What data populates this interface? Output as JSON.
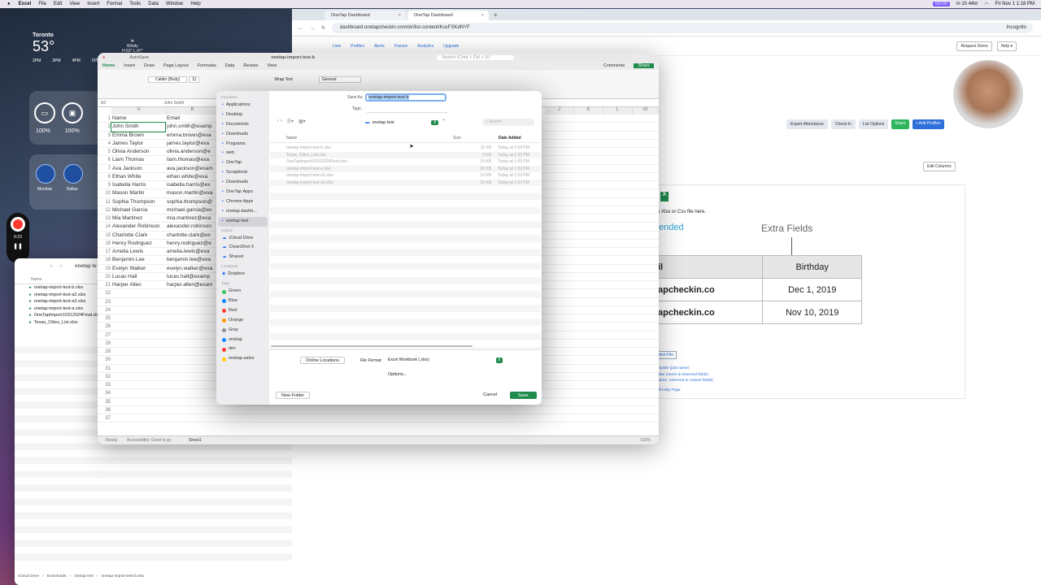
{
  "menubar": {
    "apple": "",
    "app": "Excel",
    "items": [
      "File",
      "Edit",
      "View",
      "Insert",
      "Format",
      "Tools",
      "Data",
      "Window",
      "Help"
    ],
    "right_chip": "00:00",
    "timer": "in 1h 44m",
    "datetime": "Fri Nov 1  1:18 PM"
  },
  "weather": {
    "city": "Toronto",
    "temp": "53°",
    "cond": "Windy",
    "hilo": "H:63° L:47°",
    "hours": [
      "2PM",
      "3PM",
      "4PM",
      "5PM",
      "6PM"
    ],
    "temps": [
      "58°",
      "58°",
      "58°",
      "57°",
      "56°"
    ]
  },
  "battery": {
    "values": [
      "100%",
      "100%",
      "10"
    ]
  },
  "world_clocks": [
    {
      "city": "Mumbai",
      "day": "Today",
      "offset": "+9:30"
    },
    {
      "city": "Dallas",
      "day": "Today",
      "offset": "-1:00"
    },
    {
      "city": "Lon",
      "day": "",
      "offset": ""
    }
  ],
  "recorder": {
    "time": "6:23"
  },
  "finder": {
    "crumb": "onetap te",
    "header": "Name",
    "files": [
      "onetap-import-test-b.xlsx",
      "onetap-import-test-a2.xlsx",
      "onetap-import-test-a3.xlsx",
      "onetap-import-test-a.xlsx",
      "OneTapImport10312024Final.xlsx",
      "Texas_Cities_List.xlsx"
    ],
    "path": [
      "iCloud Drive",
      "Downloads",
      "onetap test",
      "onetap-import-test-b.xlsx"
    ]
  },
  "browser": {
    "tabs": [
      {
        "label": "OneTap Dashboard"
      },
      {
        "label": "OneTap Dashboard"
      }
    ],
    "url": "dashboard.onetapcheckin.com/d#/list-content/KusFSKdNYF",
    "incognito": "Incognito",
    "nav": [
      "Lists",
      "Profiles",
      "Alerts",
      "Passes",
      "Analytics",
      "Upgrade"
    ],
    "top_buttons": [
      "Request Demo",
      "Help ▾"
    ],
    "actions": [
      "Export Attendance",
      "Check-In",
      "List Options",
      "Share",
      "+ Add Profiles"
    ],
    "edit_columns": "Edit Columns",
    "drop_text": "n Xlsx or Csv file here.",
    "ended": "ended",
    "extra_fields": "Extra Fields",
    "table_header": [
      "il",
      "Birthday"
    ],
    "table_rows": [
      [
        "apcheckin.co",
        "Dec 1, 2019"
      ],
      [
        "apcheckin.co",
        "Nov 10, 2019"
      ]
    ],
    "select_file": "elect File",
    "links": [
      "mplate (just name)",
      "date (name & reserved fields)",
      "name, reserved & custom fields)"
    ],
    "help": "ull Help Page"
  },
  "excel": {
    "autosave": "AutoSave",
    "title": "onetap-import-test-b",
    "search": "Search (Cmd + Ctrl + U)",
    "ribbon_tabs": [
      "Home",
      "Insert",
      "Draw",
      "Page Layout",
      "Formulas",
      "Data",
      "Review",
      "View"
    ],
    "comments": "Comments",
    "share": "Share",
    "font": "Calibri (Body)",
    "size": "11",
    "wrap": "Wrap Text",
    "numfmt": "General",
    "cellref": "A2",
    "formula": "John Smith",
    "columns": [
      "A",
      "B",
      "C",
      "D",
      "E",
      "F",
      "G",
      "H",
      "I",
      "J",
      "K",
      "L",
      "M"
    ],
    "rows": [
      [
        "1",
        "Name",
        "Email"
      ],
      [
        "2",
        "John Smith",
        "john.smith@examp"
      ],
      [
        "3",
        "Emma Brown",
        "emma.brown@exa"
      ],
      [
        "4",
        "James Taylor",
        "james.taylor@exa"
      ],
      [
        "5",
        "Olivia Anderson",
        "olivia.anderson@e"
      ],
      [
        "6",
        "Liam Thomas",
        "liam.thomas@exa"
      ],
      [
        "7",
        "Ava Jackson",
        "ava.jackson@exam"
      ],
      [
        "8",
        "Ethan White",
        "ethan.white@exa"
      ],
      [
        "9",
        "Isabella Harris",
        "isabella.harris@ex"
      ],
      [
        "10",
        "Mason Martin",
        "mason.martin@exa"
      ],
      [
        "11",
        "Sophia Thompson",
        "sophia.thompson@"
      ],
      [
        "12",
        "Michael Garcia",
        "michael.garcia@ex"
      ],
      [
        "13",
        "Mia Martinez",
        "mia.martinez@exa"
      ],
      [
        "14",
        "Alexander Robinson",
        "alexander.robinson"
      ],
      [
        "15",
        "Charlotte Clark",
        "charlotte.clark@ex"
      ],
      [
        "16",
        "Henry Rodriguez",
        "henry.rodriguez@e"
      ],
      [
        "17",
        "Amelia Lewis",
        "amelia.lewis@exa"
      ],
      [
        "18",
        "Benjamin Lee",
        "benjamin.lee@exa"
      ],
      [
        "19",
        "Evelyn Walker",
        "evelyn.walker@exa"
      ],
      [
        "20",
        "Lucas Hall",
        "lucas.hall@examp"
      ],
      [
        "21",
        "Harper Allen",
        "harper.allen@exam"
      ],
      [
        "22",
        "",
        ""
      ],
      [
        "23",
        "",
        ""
      ],
      [
        "24",
        "",
        ""
      ],
      [
        "25",
        "",
        ""
      ],
      [
        "26",
        "",
        ""
      ],
      [
        "27",
        "",
        ""
      ],
      [
        "28",
        "",
        ""
      ],
      [
        "29",
        "",
        ""
      ],
      [
        "30",
        "",
        ""
      ],
      [
        "31",
        "",
        ""
      ],
      [
        "32",
        "",
        ""
      ],
      [
        "33",
        "",
        ""
      ],
      [
        "34",
        "",
        ""
      ],
      [
        "35",
        "",
        ""
      ],
      [
        "36",
        "",
        ""
      ],
      [
        "37",
        "",
        ""
      ]
    ],
    "sheet": "Sheet1",
    "status": "Ready",
    "accessibility": "Accessibility: Good to go",
    "zoom": "162%"
  },
  "dialog": {
    "save_as_label": "Save As:",
    "save_as_value": "onetap-import-test-b",
    "tags_label": "Tags:",
    "location": "onetap test",
    "search_placeholder": "Search",
    "col_name": "Name",
    "col_size": "Size",
    "col_date": "Date Added",
    "files": [
      {
        "name": "onetap-import-test-b.xlsx",
        "size": "11 KB",
        "date": "Today at 1:04 PM"
      },
      {
        "name": "Texas_Cities_List.xlsx",
        "size": "9 KB",
        "date": "Today at 1:03 PM"
      },
      {
        "name": "OneTapImport10312024Final.xlsx",
        "size": "19 KB",
        "date": "Today at 1:03 PM"
      },
      {
        "name": "onetap-import-test-a.xlsx",
        "size": "20 KB",
        "date": "Today at 1:03 PM"
      },
      {
        "name": "onetap-import-test-a3.xlsx",
        "size": "19 KB",
        "date": "Today at 1:03 PM"
      },
      {
        "name": "onetap-import-test-a2.xlsx",
        "size": "19 KB",
        "date": "Today at 1:03 PM"
      }
    ],
    "online_locations": "Online Locations",
    "file_format_label": "File Format:",
    "file_format_value": "Excel Workbook (.xlsx)",
    "options": "Options...",
    "new_folder": "New Folder",
    "cancel": "Cancel",
    "save": "Save",
    "sidebar": {
      "favorites_header": "Favorites",
      "favorites": [
        "Applications",
        "Desktop",
        "Documents",
        "Downloads",
        "Programs",
        "web",
        "OneTap",
        "Scrapbook",
        "Downloads",
        "OneTap Apps",
        "Chrome Apps",
        "onetap dashb...",
        "onetap test"
      ],
      "icloud_header": "iCloud",
      "icloud": [
        "iCloud Drive",
        "CleanShot X",
        "Shared"
      ],
      "locations_header": "Locations",
      "locations": [
        "Dropbox"
      ],
      "tags_header": "Tags",
      "tags": [
        {
          "label": "Green",
          "color": "#34c759"
        },
        {
          "label": "Blue",
          "color": "#0a84ff"
        },
        {
          "label": "Red",
          "color": "#ff3b30"
        },
        {
          "label": "Orange",
          "color": "#ff9500"
        },
        {
          "label": "Gray",
          "color": "#8e8e93"
        },
        {
          "label": "onetap",
          "color": "#0a84ff"
        },
        {
          "label": "dev",
          "color": "#ff3b30"
        },
        {
          "label": "onetap-sales",
          "color": "#ffcc00"
        }
      ]
    }
  }
}
